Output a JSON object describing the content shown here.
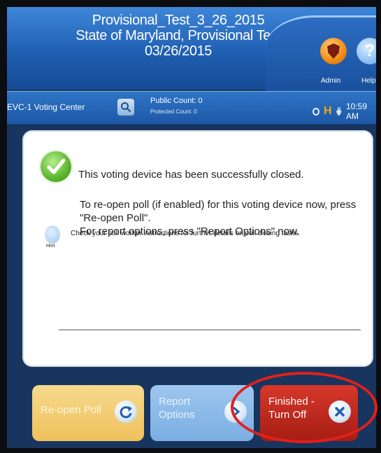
{
  "header": {
    "title_lines": [
      "Provisional_Test_3_26_2015",
      "State of Maryland, Provisional Test",
      "03/26/2015"
    ],
    "admin_label": "Admin",
    "help_label": "Help",
    "help_glyph": "?"
  },
  "statusbar": {
    "center_name": "EVC-1 Voting Center",
    "public_count": "Public Count: 0",
    "protected_count": "Protected Count: 0",
    "h_indicator": "H",
    "time": "10:59 AM",
    "icons": [
      "search-icon",
      "status-circle-icon",
      "h-indicator-icon",
      "power-plug-icon"
    ]
  },
  "panel": {
    "message": "This voting device has been successfully closed.",
    "instructions": [
      "To re-open poll (if enabled) for this voting device now, press",
      "\"Re-open Poll\".",
      "For report options, press \"Report Options\" now."
    ],
    "hint_label": "Hint",
    "hint": "Check your poll worker instructions for further details on poll closing tasks."
  },
  "buttons": {
    "reopen": "Re-open Poll",
    "report_lines": [
      "Report",
      "Options"
    ],
    "finish_lines": [
      "Finished -",
      "Turn Off"
    ]
  },
  "colors": {
    "header": "#1f5fb2",
    "finish_button": "#c02a1f",
    "reopen_button": "#efc15c",
    "report_button": "#8ebae8",
    "highlight": "#e2201c"
  }
}
